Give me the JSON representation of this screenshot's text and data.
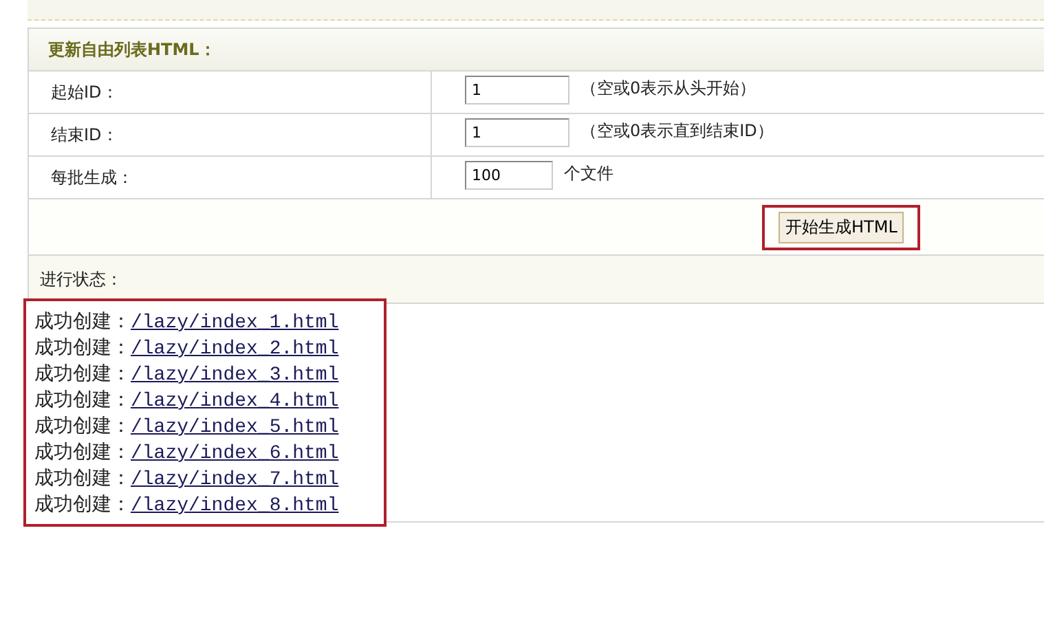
{
  "panel": {
    "title": "更新自由列表HTML："
  },
  "fields": [
    {
      "label": "起始ID：",
      "value": "1",
      "hint": "（空或0表示从头开始）",
      "kind": "wide"
    },
    {
      "label": "结束ID：",
      "value": "1",
      "hint": "（空或0表示直到结束ID）",
      "kind": "wide"
    },
    {
      "label": "每批生成：",
      "value": "100",
      "hint": "个文件",
      "kind": "narrow"
    }
  ],
  "submit": {
    "label": "开始生成HTML"
  },
  "status": {
    "title": "进行状态：",
    "entries": [
      {
        "prefix": "成功创建：",
        "link": "/lazy/index_1.html"
      },
      {
        "prefix": "成功创建：",
        "link": "/lazy/index_2.html"
      },
      {
        "prefix": "成功创建：",
        "link": "/lazy/index_3.html"
      },
      {
        "prefix": "成功创建：",
        "link": "/lazy/index_4.html"
      },
      {
        "prefix": "成功创建：",
        "link": "/lazy/index_5.html"
      },
      {
        "prefix": "成功创建：",
        "link": "/lazy/index_6.html"
      },
      {
        "prefix": "成功创建：",
        "link": "/lazy/index_7.html"
      },
      {
        "prefix": "成功创建：",
        "link": "/lazy/index_8.html"
      }
    ]
  }
}
